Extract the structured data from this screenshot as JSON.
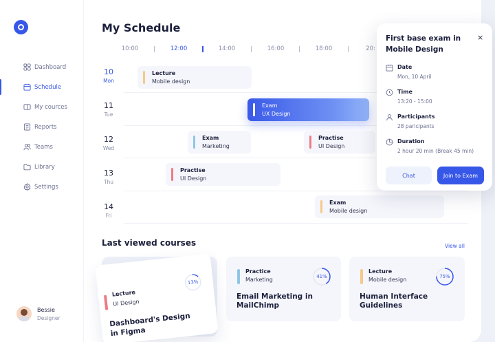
{
  "sidebar": {
    "items": [
      {
        "label": "Dashboard",
        "icon": "grid-icon"
      },
      {
        "label": "Schedule",
        "icon": "calendar-icon"
      },
      {
        "label": "My cources",
        "icon": "book-icon"
      },
      {
        "label": "Reports",
        "icon": "report-icon"
      },
      {
        "label": "Teams",
        "icon": "users-icon"
      },
      {
        "label": "Library",
        "icon": "folder-icon"
      },
      {
        "label": "Settings",
        "icon": "gear-icon"
      }
    ],
    "user": {
      "name": "Bessie",
      "role": "Designer"
    }
  },
  "schedule": {
    "title": "My Schedule",
    "times": [
      "10:00",
      "12:00",
      "14:00",
      "16:00",
      "18:00",
      "20:"
    ],
    "active_time": "12:00",
    "days": [
      {
        "num": "10",
        "name": "Mon"
      },
      {
        "num": "11",
        "name": "Tue"
      },
      {
        "num": "12",
        "name": "Wed"
      },
      {
        "num": "13",
        "name": "Thu"
      },
      {
        "num": "14",
        "name": "Fri"
      }
    ],
    "events": [
      {
        "type": "Lecture",
        "subject": "Mobile design"
      },
      {
        "type": "Exam",
        "subject": "UX Design"
      },
      {
        "type": "Exam",
        "subject": "Marketing"
      },
      {
        "type": "Practise",
        "subject": "UI Design"
      },
      {
        "type": "Practise",
        "subject": "UI Design"
      },
      {
        "type": "Exam",
        "subject": "Mobile design"
      }
    ]
  },
  "courses": {
    "title": "Last viewed courses",
    "view_all": "View all",
    "items": [
      {
        "type": "Lecture",
        "subject": "UI Design",
        "title": "Dashboard's Design in Figma",
        "progress": "13%"
      },
      {
        "type": "Practice",
        "subject": "Marketing",
        "title": "Email Marketing in MailChimp",
        "progress": "41%"
      },
      {
        "type": "Lecture",
        "subject": "Mobile design",
        "title": "Human Interface Guidelines",
        "progress": "75%"
      }
    ]
  },
  "popover": {
    "title": "First base exam in Mobile Design",
    "close": "×",
    "date_label": "Date",
    "date_value": "Mon, 10 April",
    "time_label": "Time",
    "time_value": "13:20 - 15:00",
    "participants_label": "Participants",
    "participants_value": "28 paricipants",
    "duration_label": "Duration",
    "duration_value": "2 hour 20 min (Break 45 min)",
    "chat": "Chat",
    "join": "Join to Exam"
  },
  "colors": {
    "accent": "#3757e8",
    "lecture": "#f4c98a",
    "exam": "#8fc6e6",
    "practise": "#ef7b84"
  }
}
